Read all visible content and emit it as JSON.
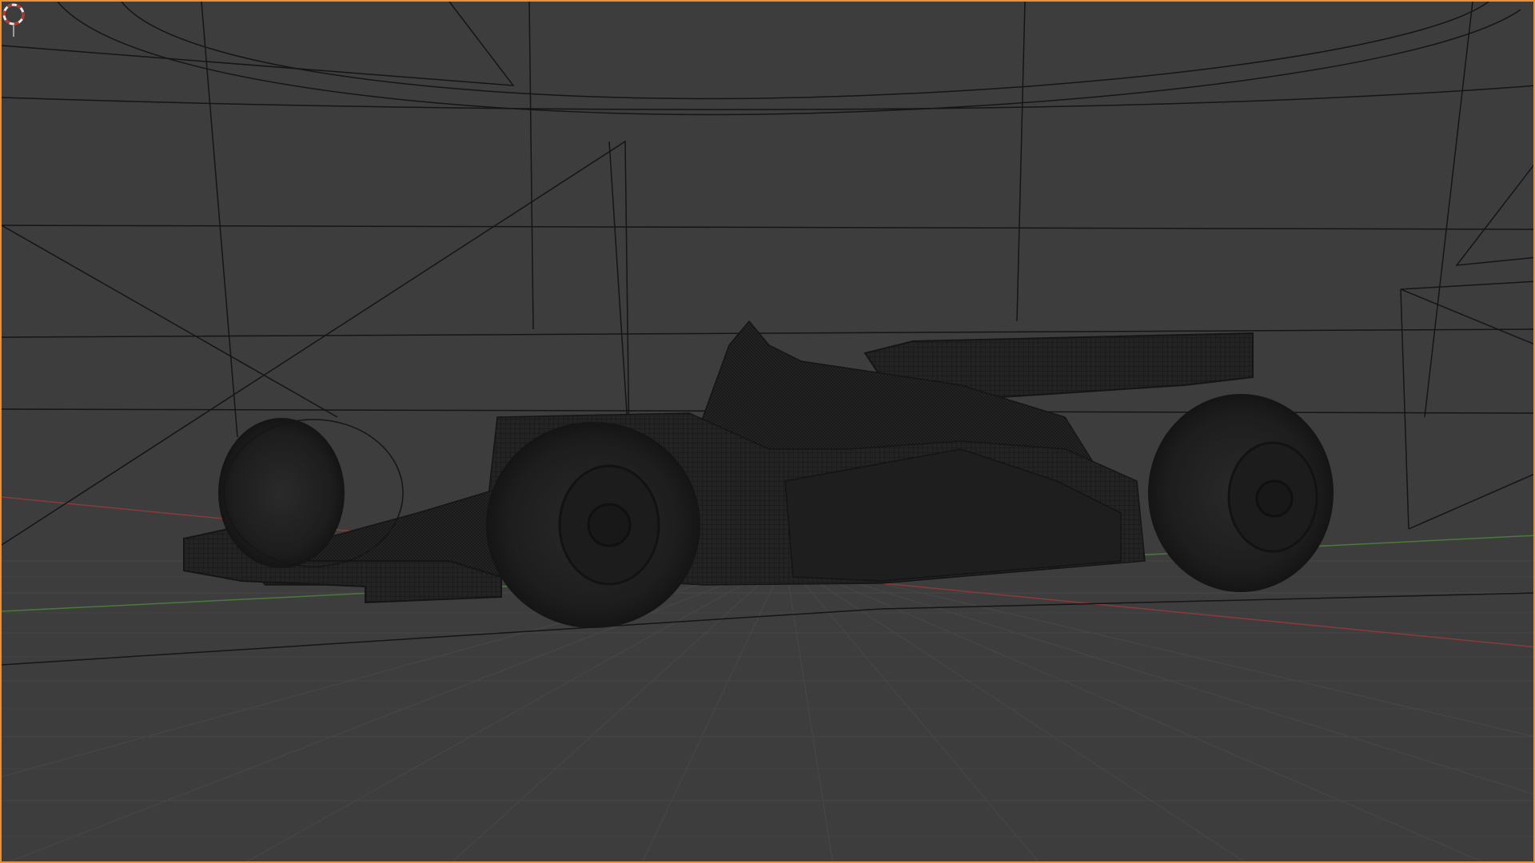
{
  "viewport": {
    "mode": "3d-viewport",
    "active_border_color": "#e8913a",
    "background_color": "#3d3d3d",
    "grid_color": "#4a4a4a",
    "x_axis_color": "#8a3a3a",
    "y_axis_color": "#4a7a3a",
    "wire_color": "#141414",
    "mesh_fill_color": "#1f1f1f"
  },
  "scene": {
    "objects": [
      {
        "name": "race-car",
        "display": "wireframe-on-solid"
      },
      {
        "name": "environment-backdrop",
        "display": "wireframe"
      }
    ],
    "cursor": {
      "name": "3d-cursor-icon",
      "colors": [
        "#c0302a",
        "#e8e8e8"
      ]
    }
  }
}
